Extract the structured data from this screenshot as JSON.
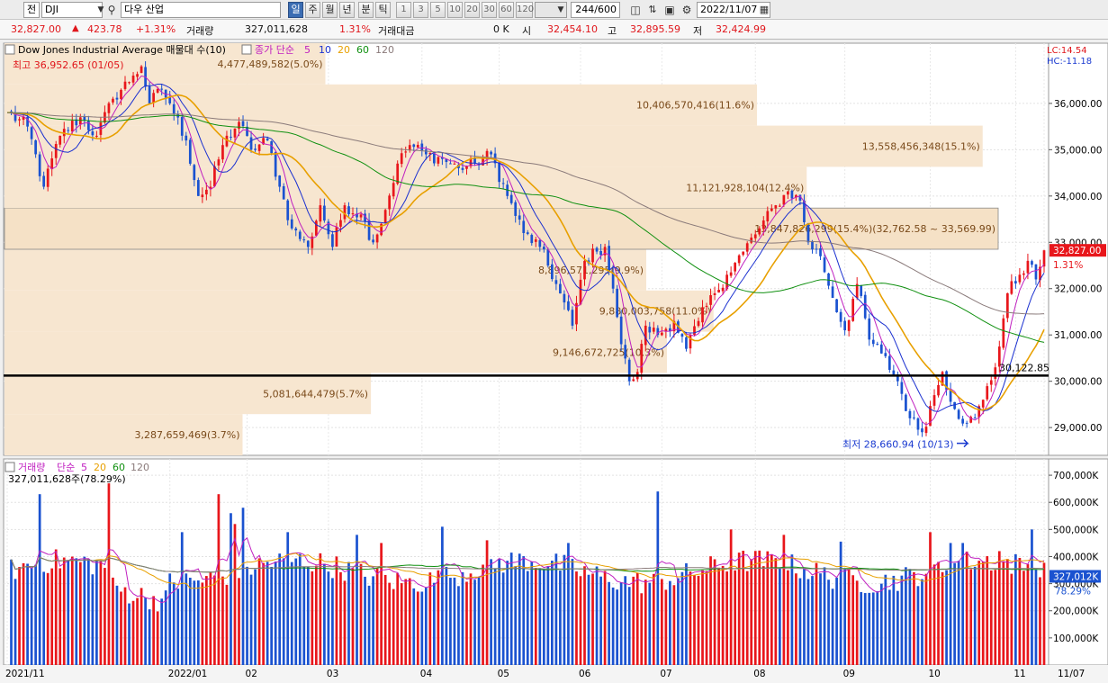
{
  "toolbar": {
    "market_label": "전",
    "symbol": "DJI",
    "name": "다우 산업",
    "periods": [
      "일",
      "주",
      "월",
      "년",
      "분",
      "틱"
    ],
    "active_period": "일",
    "intervals": [
      "1",
      "3",
      "5",
      "10",
      "20",
      "30",
      "60",
      "120"
    ],
    "count": "244",
    "count_total": "/600",
    "date": "2022/11/07",
    "icons": [
      "magnifier-icon",
      "chart-type-icon",
      "chart-compare-icon",
      "save-icon",
      "gear-icon",
      "calendar-icon"
    ]
  },
  "infobar": {
    "price": "32,827.00",
    "change": "423.78",
    "change_pct": "+1.31%",
    "volume_label": "거래량",
    "volume": "327,011,628",
    "volume_pct": "1.31%",
    "amount_label": "거래대금",
    "amount": "0 K",
    "open_label": "시",
    "open": "32,454.10",
    "high_label": "고",
    "high": "32,895.59",
    "low_label": "저",
    "low": "32,424.99"
  },
  "chart_data": [
    {
      "type": "candlestick",
      "title": "Dow Jones Industrial Average 매물대 수(10)",
      "ma_title": "종가 단순",
      "ma_periods": [
        "5",
        "10",
        "20",
        "60",
        "120"
      ],
      "ma_colors": [
        "#c020c0",
        "#1a30d0",
        "#e8a000",
        "#109010",
        "#8a7a7a"
      ],
      "up_color": "#e8161b",
      "down_color": "#1a52d0",
      "y_axis": {
        "min": 28400,
        "max": 37300,
        "ticks": [
          29000,
          30000,
          31000,
          32000,
          33000,
          34000,
          35000,
          36000
        ],
        "tick_labels": [
          "29,000.00",
          "30,000.00",
          "31,000.00",
          "32,000.00",
          "33,000.00",
          "34,000.00",
          "35,000.00",
          "36,000.00"
        ]
      },
      "x_axis": {
        "labels": [
          "2021/11",
          "2022/01",
          "02",
          "03",
          "04",
          "05",
          "06",
          "07",
          "08",
          "09",
          "10",
          "11",
          "11/07"
        ],
        "label_days": [
          0,
          40,
          59,
          79,
          102,
          121,
          141,
          161,
          184,
          206,
          227,
          248,
          255
        ]
      },
      "days": 255,
      "anchors": [
        [
          0,
          35800
        ],
        [
          5,
          35500
        ],
        [
          9,
          34200
        ],
        [
          13,
          35300
        ],
        [
          18,
          35700
        ],
        [
          22,
          35300
        ],
        [
          26,
          36100
        ],
        [
          31,
          36600
        ],
        [
          33,
          36800
        ],
        [
          35,
          36000
        ],
        [
          38,
          36300
        ],
        [
          40,
          36000
        ],
        [
          44,
          35200
        ],
        [
          47,
          34000
        ],
        [
          50,
          34200
        ],
        [
          53,
          35100
        ],
        [
          57,
          35600
        ],
        [
          60,
          35000
        ],
        [
          64,
          35200
        ],
        [
          67,
          34200
        ],
        [
          70,
          33300
        ],
        [
          74,
          32900
        ],
        [
          77,
          33800
        ],
        [
          80,
          32900
        ],
        [
          83,
          33800
        ],
        [
          87,
          33600
        ],
        [
          90,
          33000
        ],
        [
          93,
          33700
        ],
        [
          96,
          34700
        ],
        [
          99,
          35100
        ],
        [
          103,
          34900
        ],
        [
          107,
          34800
        ],
        [
          111,
          34600
        ],
        [
          115,
          34700
        ],
        [
          119,
          34900
        ],
        [
          123,
          34000
        ],
        [
          127,
          33200
        ],
        [
          131,
          32900
        ],
        [
          135,
          32100
        ],
        [
          139,
          31200
        ],
        [
          142,
          32600
        ],
        [
          145,
          32800
        ],
        [
          147,
          32900
        ],
        [
          149,
          32000
        ],
        [
          151,
          30800
        ],
        [
          153,
          30000
        ],
        [
          155,
          30200
        ],
        [
          157,
          31200
        ],
        [
          160,
          31000
        ],
        [
          164,
          31300
        ],
        [
          167,
          30700
        ],
        [
          170,
          31300
        ],
        [
          174,
          31900
        ],
        [
          177,
          32300
        ],
        [
          181,
          32800
        ],
        [
          185,
          33300
        ],
        [
          189,
          33800
        ],
        [
          192,
          34100
        ],
        [
          195,
          33900
        ],
        [
          197,
          33000
        ],
        [
          200,
          32700
        ],
        [
          203,
          31800
        ],
        [
          206,
          31100
        ],
        [
          209,
          32100
        ],
        [
          212,
          30900
        ],
        [
          215,
          30600
        ],
        [
          219,
          30000
        ],
        [
          222,
          29200
        ],
        [
          225,
          28900
        ],
        [
          228,
          29700
        ],
        [
          230,
          30200
        ],
        [
          233,
          29400
        ],
        [
          236,
          29100
        ],
        [
          238,
          29200
        ],
        [
          240,
          29600
        ],
        [
          243,
          30300
        ],
        [
          246,
          31900
        ],
        [
          249,
          32300
        ],
        [
          251,
          32600
        ],
        [
          253,
          32200
        ],
        [
          255,
          32827
        ]
      ],
      "annotations": {
        "high": "최고 36,952.65 (01/05)",
        "low": "최저 28,660.94 (10/13)",
        "support_level": 30122.85,
        "support_label": "30,122.85",
        "current_label": "32,827.00",
        "current_pct": "1.31%",
        "lc": "LC:14.54",
        "hc": "HC:-11.18"
      },
      "volume_profile": [
        {
          "label": "3,287,659,469(3.7%)",
          "lo": 28400,
          "hi": 29290,
          "width": 0.23
        },
        {
          "label": "5,081,644,479(5.7%)",
          "lo": 29290,
          "hi": 30180,
          "width": 0.354
        },
        {
          "label": "9,146,672,725(10.3%)",
          "lo": 30180,
          "hi": 31070,
          "width": 0.64
        },
        {
          "label": "9,880,003,758(11.0%)",
          "lo": 31070,
          "hi": 31960,
          "width": 0.685
        },
        {
          "label": "8,896,571,295(9.9%)",
          "lo": 31960,
          "hi": 32850,
          "width": 0.62
        },
        {
          "label": "13,847,826,299(15.4%)(32,762.58 ~ 33,569.99)",
          "lo": 32850,
          "hi": 33740,
          "width": 0.96,
          "highlight": true
        },
        {
          "label": "11,121,928,104(12.4%)",
          "lo": 33740,
          "hi": 34630,
          "width": 0.775
        },
        {
          "label": "13,558,456,348(15.1%)",
          "lo": 34630,
          "hi": 35520,
          "width": 0.945
        },
        {
          "label": "10,406,570,416(11.6%)",
          "lo": 35520,
          "hi": 36410,
          "width": 0.727
        },
        {
          "label": "4,477,489,582(5.0%)",
          "lo": 36410,
          "hi": 37300,
          "width": 0.31
        }
      ]
    },
    {
      "type": "bar",
      "title": "거래량",
      "ma_title": "단순",
      "ma_periods": [
        "5",
        "20",
        "60",
        "120"
      ],
      "ma_colors": [
        "#c020c0",
        "#e8a000",
        "#109010",
        "#8a7a7a"
      ],
      "current_label": "327,011,628주(78.29%)",
      "y_axis": {
        "min": 0,
        "max": 760000,
        "ticks": [
          100000,
          200000,
          300000,
          400000,
          500000,
          600000,
          700000
        ],
        "tick_labels": [
          "100,000K",
          "200,000K",
          "300,000K",
          "400,000K",
          "500,000K",
          "600,000K",
          "700,000K"
        ]
      },
      "badge": "327,012K",
      "badge_pct": "78.29%",
      "spikes": [
        [
          8,
          630000
        ],
        [
          25,
          670000
        ],
        [
          43,
          490000
        ],
        [
          52,
          630000
        ],
        [
          55,
          560000
        ],
        [
          56,
          520000
        ],
        [
          58,
          580000
        ],
        [
          69,
          490000
        ],
        [
          86,
          480000
        ],
        [
          92,
          450000
        ],
        [
          107,
          510000
        ],
        [
          118,
          460000
        ],
        [
          138,
          450000
        ],
        [
          160,
          640000
        ],
        [
          178,
          500000
        ],
        [
          191,
          480000
        ],
        [
          205,
          455000
        ],
        [
          227,
          490000
        ],
        [
          232,
          450000
        ],
        [
          235,
          450000
        ],
        [
          244,
          420000
        ],
        [
          252,
          500000
        ]
      ]
    }
  ]
}
